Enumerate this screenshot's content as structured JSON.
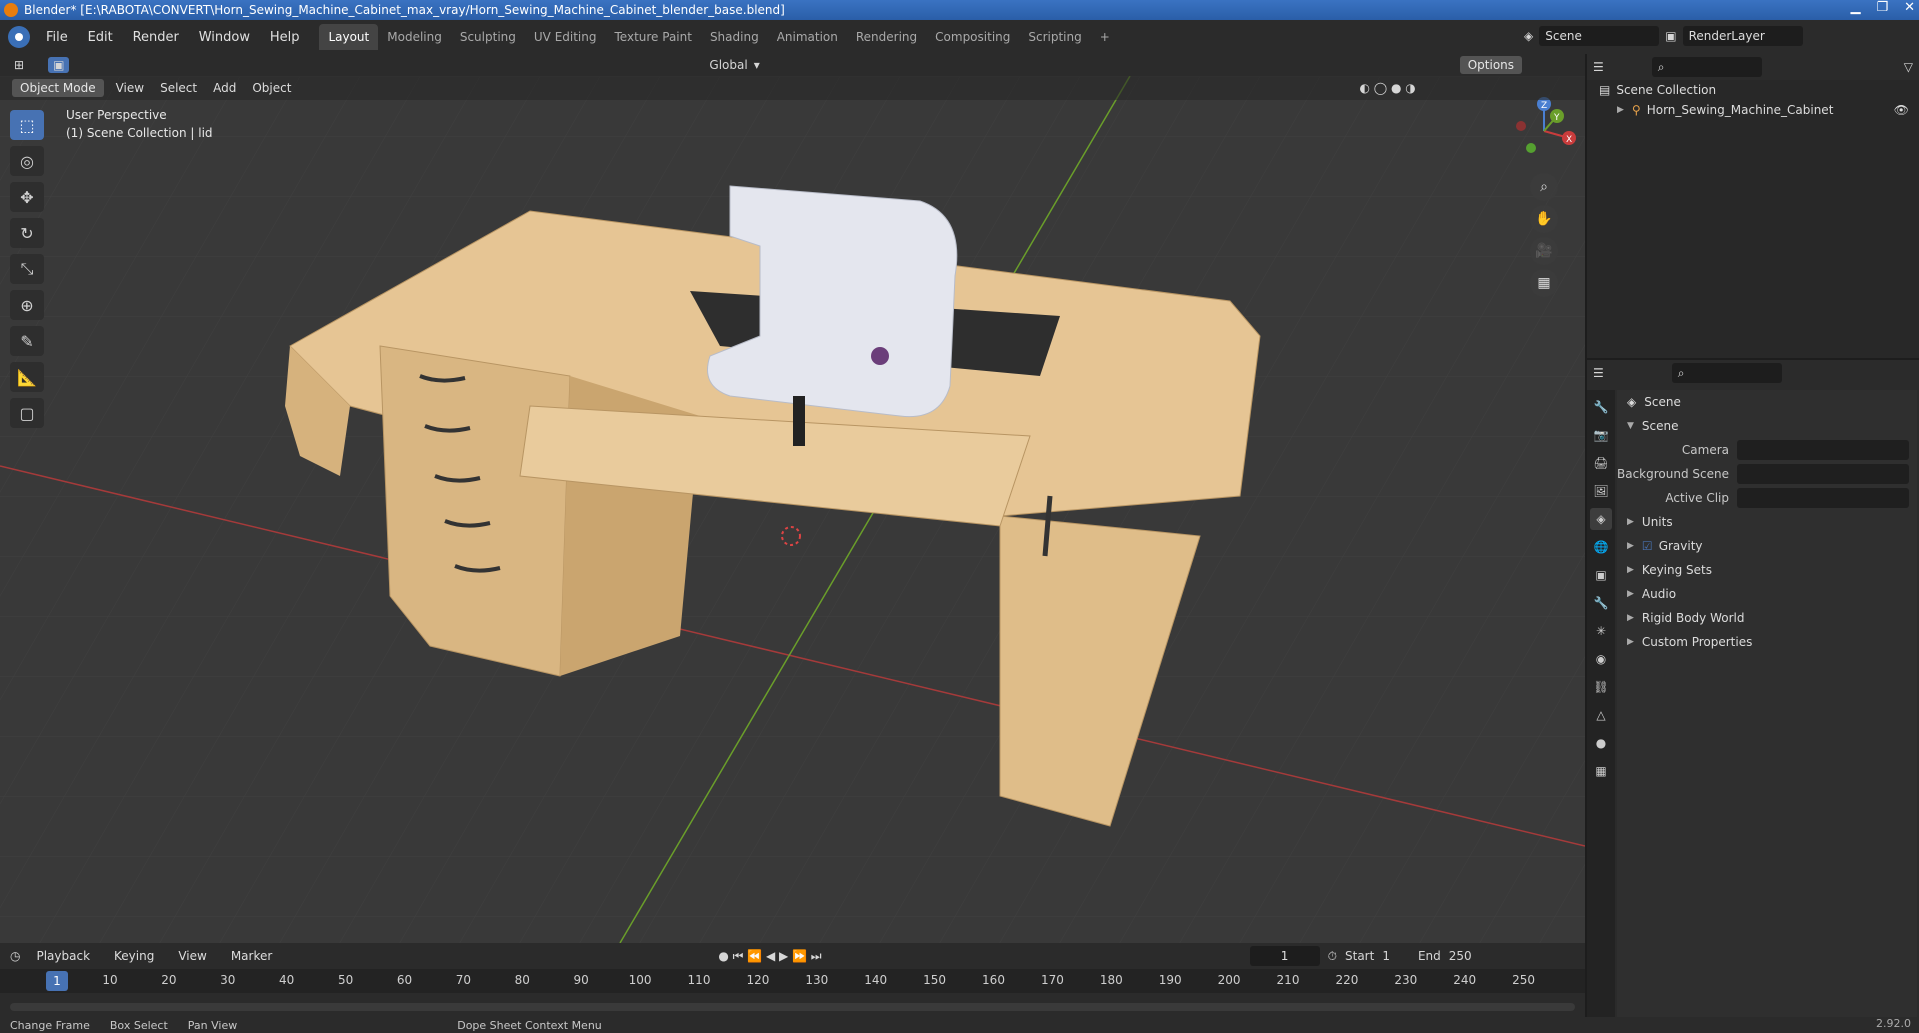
{
  "window": {
    "title": "Blender* [E:\\RABOTA\\CONVERT\\Horn_Sewing_Machine_Cabinet_max_vray/Horn_Sewing_Machine_Cabinet_blender_base.blend]"
  },
  "menu": [
    "File",
    "Edit",
    "Render",
    "Window",
    "Help"
  ],
  "workspaces": [
    "Layout",
    "Modeling",
    "Sculpting",
    "UV Editing",
    "Texture Paint",
    "Shading",
    "Animation",
    "Rendering",
    "Compositing",
    "Scripting"
  ],
  "active_workspace": "Layout",
  "scene_field": "Scene",
  "renderlayer_field": "RenderLayer",
  "tool_header": {
    "transform": "Global",
    "options": "Options"
  },
  "viewport_header": {
    "mode": "Object Mode",
    "menus": [
      "View",
      "Select",
      "Add",
      "Object"
    ]
  },
  "viewport": {
    "perspective": "User Perspective",
    "collection": "(1) Scene Collection | lid",
    "gizmo": {
      "z": "Z",
      "y": "Y",
      "x": "X"
    }
  },
  "outliner": {
    "root": "Scene Collection",
    "items": [
      "Horn_Sewing_Machine_Cabinet"
    ]
  },
  "properties": {
    "header": "Scene",
    "panel": "Scene",
    "fields": [
      {
        "label": "Camera"
      },
      {
        "label": "Background Scene"
      },
      {
        "label": "Active Clip"
      }
    ],
    "panels": [
      "Units",
      "Gravity",
      "Keying Sets",
      "Audio",
      "Rigid Body World",
      "Custom Properties"
    ]
  },
  "timeline": {
    "menus": [
      "Playback",
      "Keying",
      "View",
      "Marker"
    ],
    "current_frame": "1",
    "start_label": "Start",
    "start": "1",
    "end_label": "End",
    "end": "250",
    "ticks": [
      "10",
      "20",
      "30",
      "40",
      "50",
      "60",
      "70",
      "80",
      "90",
      "100",
      "110",
      "120",
      "130",
      "140",
      "150",
      "160",
      "170",
      "180",
      "190",
      "200",
      "210",
      "220",
      "230",
      "240",
      "250"
    ],
    "cursor": "1"
  },
  "statusbar": [
    "Change Frame",
    "Box Select",
    "Pan View",
    "Dope Sheet Context Menu"
  ],
  "version": "2.92.0",
  "colors": {
    "accent": "#4772b3",
    "x_axis": "#c93c3c",
    "y_axis": "#6a9e2a",
    "wood": "#e2c08d"
  }
}
